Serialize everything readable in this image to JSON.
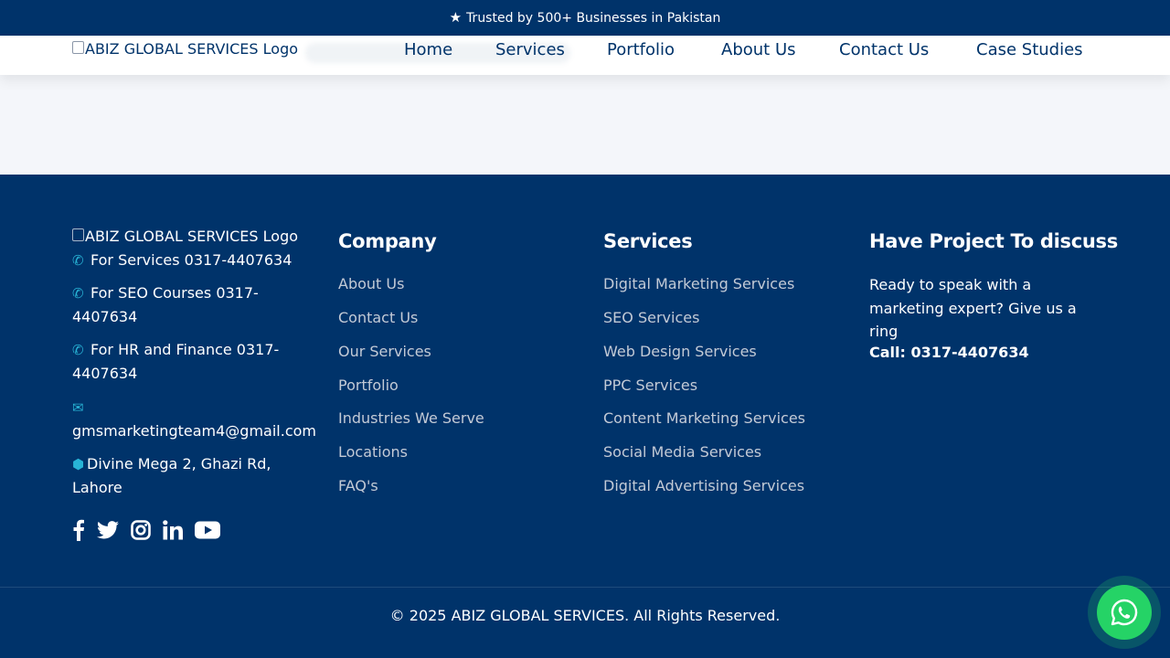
{
  "topbar": {
    "text": "Trusted by 500+ Businesses in Pakistan",
    "icon": "star-icon"
  },
  "nav": {
    "logo_alt": "ABIZ GLOBAL SERVICES Logo",
    "links": [
      "Home",
      "Services",
      "Portfolio",
      "About Us",
      "Contact Us",
      "Case Studies"
    ]
  },
  "footer": {
    "logo_alt": "ABIZ GLOBAL SERVICES Logo",
    "contact": {
      "services": "For Services 0317-4407634",
      "seo_line1": "For SEO Courses 0317-",
      "seo_line2": "4407634",
      "hr_line1": "For HR and Finance 0317-",
      "hr_line2": "4407634",
      "email": "gmsmarketingteam4@gmail.com",
      "address_line1": "Divine Mega 2, Ghazi Rd,",
      "address_line2": "Lahore"
    },
    "social": [
      "facebook-icon",
      "twitter-icon",
      "instagram-icon",
      "linkedin-icon",
      "youtube-icon"
    ],
    "company": {
      "title": "Company",
      "links": [
        "About Us",
        "Contact Us",
        "Our Services",
        "Portfolio",
        "Industries We Serve",
        "Locations",
        "FAQ's"
      ]
    },
    "services": {
      "title": "Services",
      "links": [
        "Digital Marketing Services",
        "SEO Services",
        "Web Design Services",
        "PPC Services",
        "Content Marketing Services",
        "Social Media Services",
        "Digital Advertising Services"
      ]
    },
    "discuss": {
      "title": "Have Project To discuss",
      "line1": "Ready to speak with a",
      "line2": "marketing expert? Give us a",
      "line3": "ring",
      "call": "Call: 0317-4407634"
    },
    "copyright": "© 2025 ABIZ GLOBAL SERVICES. All Rights Reserved."
  },
  "colors": {
    "primary": "#00336a",
    "accent": "#28b4d6",
    "whatsapp": "#25d366"
  }
}
